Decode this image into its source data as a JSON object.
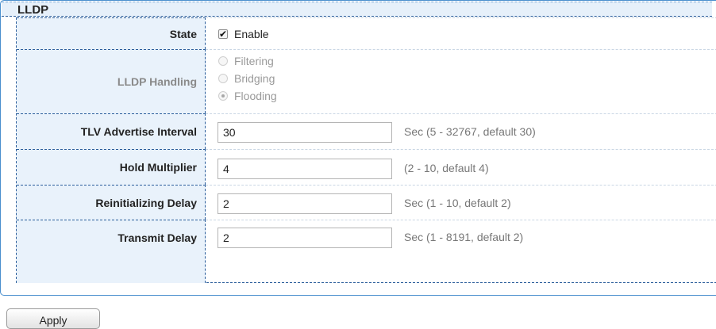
{
  "panel": {
    "title": "LLDP"
  },
  "state": {
    "label": "State",
    "checkbox_label": "Enable",
    "checked": true
  },
  "handling": {
    "label": "LLDP Handling",
    "options": [
      {
        "label": "Filtering",
        "selected": false
      },
      {
        "label": "Bridging",
        "selected": false
      },
      {
        "label": "Flooding",
        "selected": true
      }
    ]
  },
  "tlv_interval": {
    "label": "TLV Advertise Interval",
    "value": "30",
    "hint": "Sec (5 - 32767, default 30)"
  },
  "hold_multiplier": {
    "label": "Hold Multiplier",
    "value": "4",
    "hint": "(2 - 10, default 4)"
  },
  "reinit_delay": {
    "label": "Reinitializing Delay",
    "value": "2",
    "hint": "Sec (1 - 10, default 2)"
  },
  "transmit_delay": {
    "label": "Transmit Delay",
    "value": "2",
    "hint": "Sec (1 - 8191, default 2)"
  },
  "apply_label": "Apply"
}
